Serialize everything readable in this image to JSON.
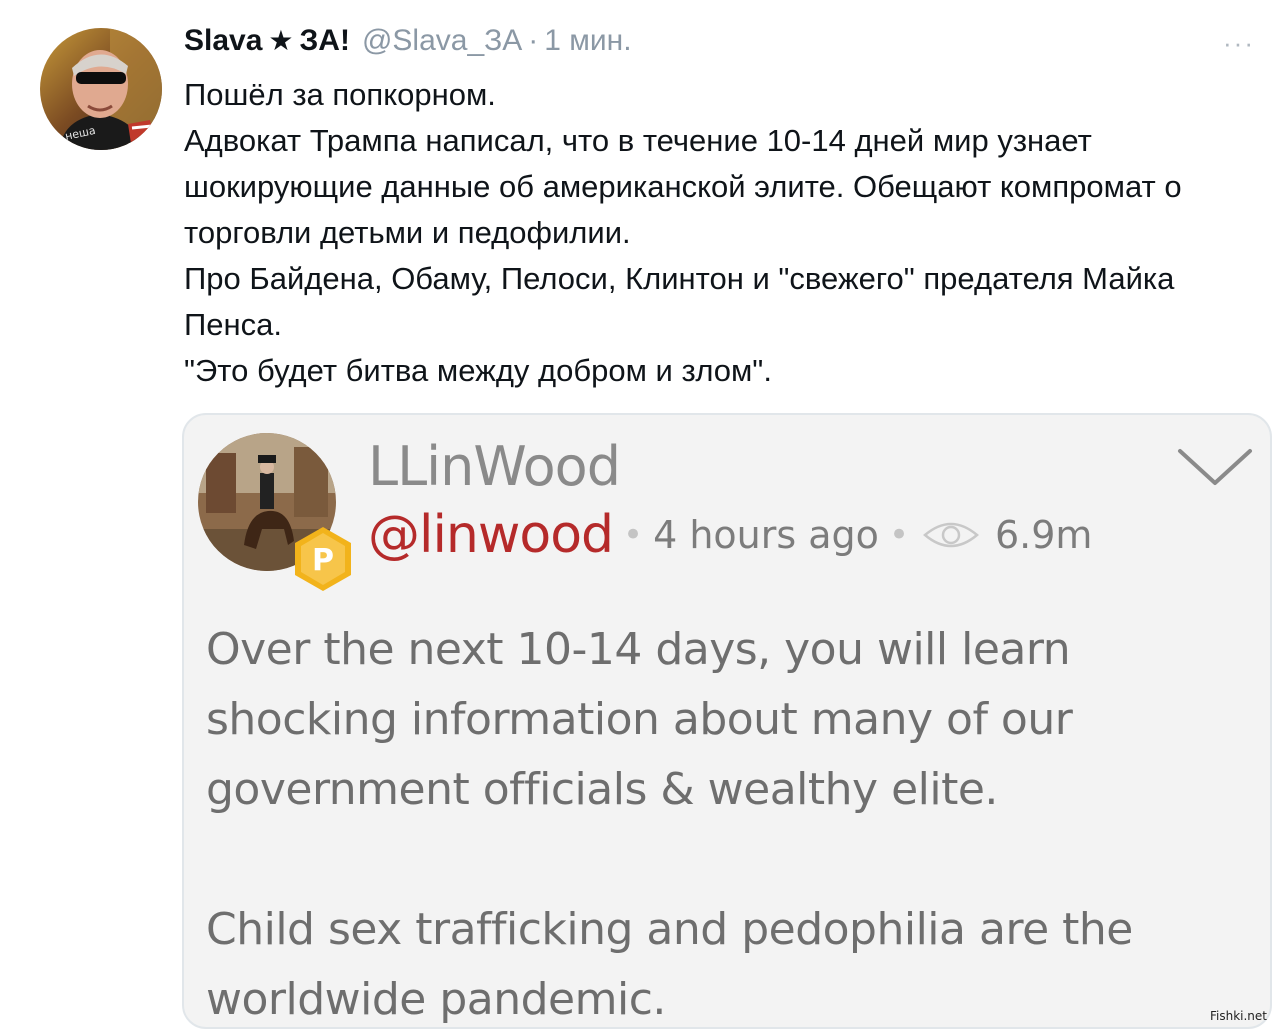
{
  "tweet": {
    "author_name": "Slava",
    "author_name_suffix": "ЗА!",
    "handle": "@Slava_ЗА",
    "separator": "·",
    "time": "1 мин.",
    "more_label": "···",
    "text_lines": [
      "Пошёл за попкорном.",
      "Адвокат Трампа написал, что в течение 10-14 дней мир узнает шокирующие данные об американской элите. Обещают компромат о торговли детьми и педофилии.",
      "Про Байдена, Обаму, Пелоси, Клинтон и \"свежего\" предателя Майка Пенса.",
      "\"Это будет битва между добром и злом\"."
    ]
  },
  "embedded_post": {
    "display_name": "LLinWood",
    "handle": "@linwood",
    "time": "4 hours ago",
    "views": "6.9m",
    "paragraph_1": "Over the next 10-14 days, you will learn shocking information about many of our government officials & wealthy elite.",
    "paragraph_2": "Child sex trafficking and pedophilia are the worldwide pandemic.",
    "badge_letter": "P"
  },
  "watermark": "Fishki.net",
  "icons": [
    "more-icon",
    "star-icon",
    "chevron-down-icon",
    "eye-icon",
    "parler-badge-icon"
  ],
  "colors": {
    "handle_gray": "#8b98a5",
    "parler_handle_red": "#b52a2a",
    "badge_gold": "#f2b31b"
  }
}
